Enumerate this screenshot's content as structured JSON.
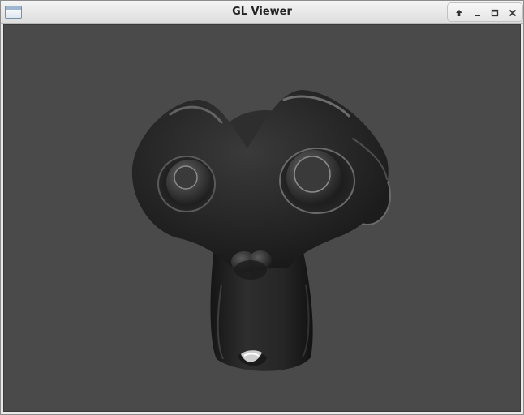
{
  "window": {
    "title": "GL Viewer",
    "controls": [
      {
        "name": "shade-up-button",
        "icon": "arrow-up-icon"
      },
      {
        "name": "minimize-button",
        "icon": "minimize-icon"
      },
      {
        "name": "maximize-button",
        "icon": "maximize-icon"
      },
      {
        "name": "close-button",
        "icon": "close-icon"
      }
    ]
  },
  "viewport": {
    "background_color": "#4a4a4a",
    "model_color": "#2a2a2a",
    "subject": "suzanne-monkey-head-3d-model"
  }
}
